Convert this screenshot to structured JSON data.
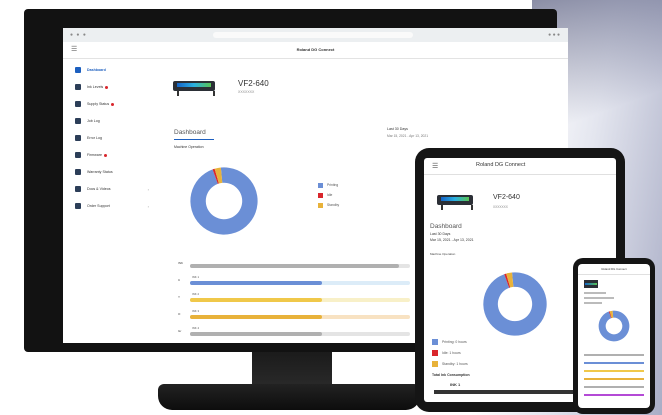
{
  "colors": {
    "blue": "#6b8fd6",
    "orange": "#e8b23a",
    "red": "#d9262c",
    "accent": "#1d5fbf",
    "yellow": "#f0c84a",
    "gray": "#b0b0b0",
    "purple": "#b44ad6",
    "track_blue": "#dcecf8",
    "track_yellow": "#f8f0c8",
    "track_orange": "#f8e2c2",
    "track_gray": "#e4e4e4",
    "track_purple": "#ecd6f4"
  },
  "app": {
    "title": "Roland DG Connect"
  },
  "sidebar": {
    "items": [
      {
        "label": "Dashboard",
        "icon": "dashboard-icon",
        "active": true,
        "badge": false
      },
      {
        "label": "Ink Levels",
        "icon": "ink-icon",
        "active": false,
        "badge": true
      },
      {
        "label": "Supply Status",
        "icon": "supply-icon",
        "active": false,
        "badge": true
      },
      {
        "label": "Job Log",
        "icon": "job-log-icon",
        "active": false,
        "badge": false
      },
      {
        "label": "Error Log",
        "icon": "error-log-icon",
        "active": false,
        "badge": false
      },
      {
        "label": "Firmware",
        "icon": "firmware-icon",
        "active": false,
        "badge": true
      },
      {
        "label": "Warranty Status",
        "icon": "warranty-icon",
        "active": false,
        "badge": false
      },
      {
        "label": "Docs & Videos",
        "icon": "docs-icon",
        "active": false,
        "badge": false
      },
      {
        "label": "Order Support",
        "icon": "cart-icon",
        "active": false,
        "badge": false
      }
    ]
  },
  "device": {
    "model": "VF2-640",
    "serial": "XXXXXXX"
  },
  "dashboard": {
    "title": "Dashboard",
    "period_label": "Last 30 Days",
    "period": "Mar 15, 2021 - Apr 13, 2021",
    "ops_title": "Machine Operation",
    "legend": [
      "Printing",
      "Idle",
      "Standby"
    ]
  },
  "ink_title": "Total Ink Consumption",
  "ink_bar_label": "INK 1",
  "chart_data": {
    "type": "pie",
    "categories": [
      "Printing",
      "Idle",
      "Standby"
    ],
    "values": [
      96,
      1,
      3
    ]
  },
  "bars": [
    {
      "label": "INK",
      "sub": "",
      "fill": 0.95,
      "color": "gray",
      "track": "track_gray",
      "value": "0 ml"
    },
    {
      "label": "C",
      "sub": "INK 1",
      "fill": 0.6,
      "color": "blue",
      "track": "track_blue",
      "value": "0 ml"
    },
    {
      "label": "Y",
      "sub": "INK 2",
      "fill": 0.6,
      "color": "yellow",
      "track": "track_yellow",
      "value": "0 ml"
    },
    {
      "label": "O",
      "sub": "INK 3",
      "fill": 0.6,
      "color": "orange",
      "track": "track_orange",
      "value": "0 ml"
    },
    {
      "label": "Gr",
      "sub": "INK 4",
      "fill": 0.6,
      "color": "gray",
      "track": "track_gray",
      "value": "0 ml"
    },
    {
      "label": "V",
      "sub": "INK 5",
      "fill": 0.6,
      "color": "purple",
      "track": "track_purple",
      "value": "0 ml"
    }
  ],
  "tablet": {
    "title": "Roland DG Connect",
    "legend": [
      "Printing: 0 hours",
      "Idle: 1 hours",
      "Standby: 1 hours"
    ]
  }
}
